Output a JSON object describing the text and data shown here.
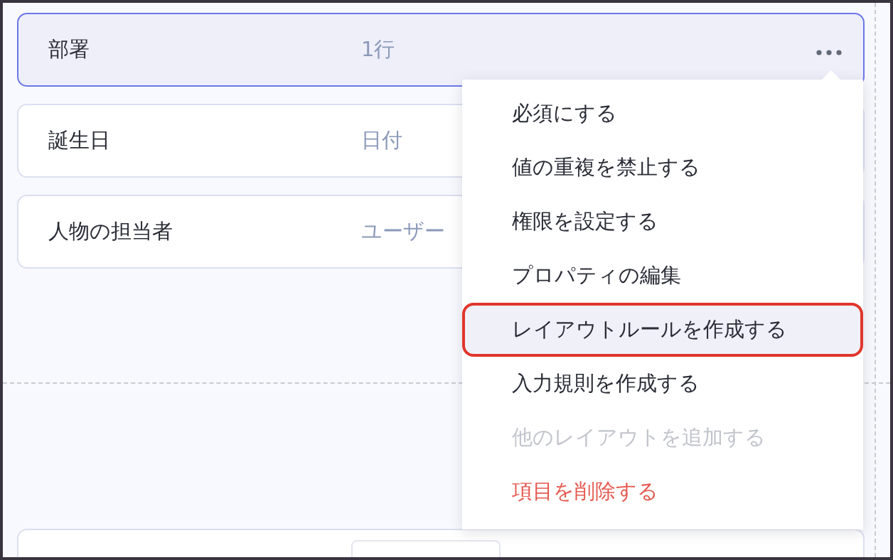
{
  "fields": [
    {
      "name": "部署",
      "type": "1行",
      "selected": true
    },
    {
      "name": "誕生日",
      "type": "日付",
      "selected": false
    },
    {
      "name": "人物の担当者",
      "type": "ユーザー",
      "selected": false
    }
  ],
  "menu": {
    "items": [
      {
        "label": "必須にする",
        "kind": "normal",
        "highlighted": false
      },
      {
        "label": "値の重複を禁止する",
        "kind": "normal",
        "highlighted": false
      },
      {
        "label": "権限を設定する",
        "kind": "normal",
        "highlighted": false
      },
      {
        "label": "プロパティの編集",
        "kind": "normal",
        "highlighted": false
      },
      {
        "label": "レイアウトルールを作成する",
        "kind": "normal",
        "highlighted": true
      },
      {
        "label": "入力規則を作成する",
        "kind": "normal",
        "highlighted": false
      },
      {
        "label": "他のレイアウトを追加する",
        "kind": "disabled",
        "highlighted": false
      },
      {
        "label": "項目を削除する",
        "kind": "danger",
        "highlighted": false
      }
    ]
  }
}
